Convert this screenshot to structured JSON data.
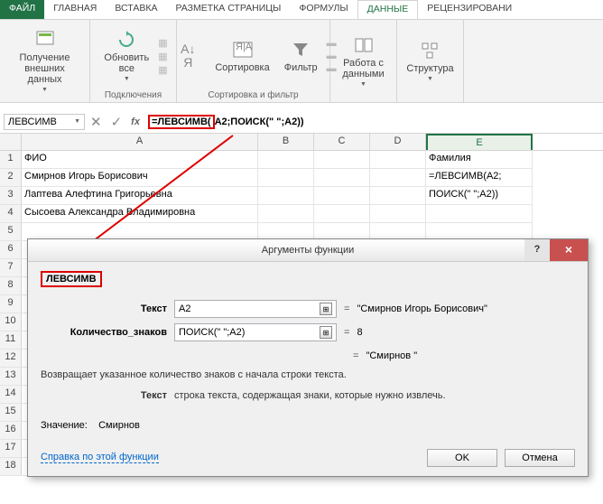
{
  "tabs": {
    "file": "ФАЙЛ",
    "home": "ГЛАВНАЯ",
    "insert": "ВСТАВКА",
    "layout": "РАЗМЕТКА СТРАНИЦЫ",
    "formulas": "ФОРМУЛЫ",
    "data": "ДАННЫЕ",
    "review": "РЕЦЕНЗИРОВАНИ"
  },
  "ribbon": {
    "get_data": "Получение\nвнешних данных",
    "refresh": "Обновить\nвсе",
    "connections_group": "Подключения",
    "sort": "Сортировка",
    "filter": "Фильтр",
    "sort_filter_group": "Сортировка и фильтр",
    "data_tools": "Работа с\nданными",
    "structure": "Структура"
  },
  "name_box": "ЛЕВСИМВ",
  "formula_highlight": "=ЛЕВСИМВ(",
  "formula_rest": "A2;ПОИСК(\" \";A2))",
  "headers": {
    "A": "A",
    "B": "B",
    "C": "C",
    "D": "D",
    "E": "E"
  },
  "row_nums": [
    "1",
    "2",
    "3",
    "4",
    "5",
    "6",
    "7",
    "8",
    "9",
    "10",
    "11",
    "12",
    "13",
    "14",
    "15",
    "16",
    "17",
    "18"
  ],
  "cells": {
    "A1": "ФИО",
    "A2": "Смирнов Игорь Борисович",
    "A3": "Лаптева Алефтина Григорьевна",
    "A4": "Сысоева Александра Владимировна",
    "E1": "Фамилия",
    "E2": "=ЛЕВСИМВ(A2;",
    "E3": "ПОИСК(\" \";A2))"
  },
  "dialog": {
    "title": "Аргументы функции",
    "func": "ЛЕВСИМВ",
    "arg1_label": "Текст",
    "arg1_value": "A2",
    "arg1_result": "\"Смирнов Игорь Борисович\"",
    "arg2_label": "Количество_знаков",
    "arg2_value": "ПОИСК(\" \";A2)",
    "arg2_result": "8",
    "result_eq": "\"Смирнов \"",
    "desc1": "Возвращает указанное количество знаков с начала строки текста.",
    "desc2_label": "Текст",
    "desc2_text": "строка текста, содержащая знаки, которые нужно извлечь.",
    "value_label": "Значение:",
    "value": "Смирнов",
    "help_link": "Справка по этой функции",
    "ok": "OK",
    "cancel": "Отмена"
  }
}
